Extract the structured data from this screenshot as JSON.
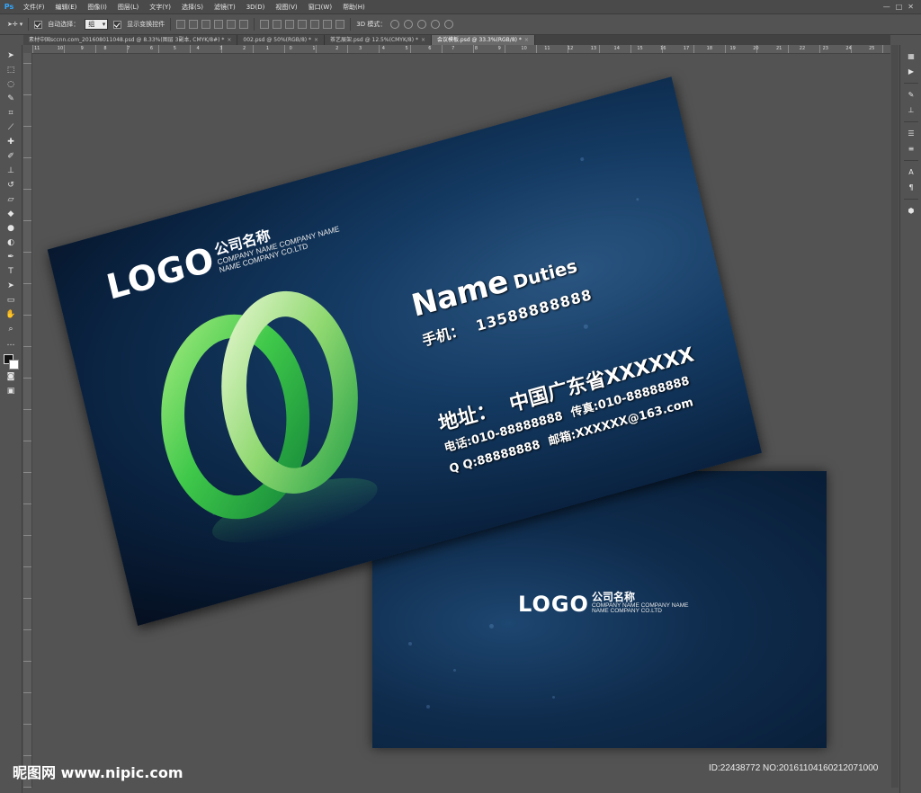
{
  "app": {
    "logo": "Ps",
    "menus": [
      "文件(F)",
      "编辑(E)",
      "图像(I)",
      "图层(L)",
      "文字(Y)",
      "选择(S)",
      "滤镜(T)",
      "3D(D)",
      "视图(V)",
      "窗口(W)",
      "帮助(H)"
    ],
    "window_controls": [
      "—",
      "□",
      "✕"
    ]
  },
  "options": {
    "auto_select_label": "自动选择：",
    "auto_select_value": "组",
    "show_transform_label": "显示变换控件",
    "mode_3d_label": "3D 模式："
  },
  "tabs": [
    {
      "label": "素材中国sccnn.com_20160801104​8.psd @ 8.33%(图层 3副本, CMYK/8#) *",
      "active": false
    },
    {
      "label": "002.psd @ 50%(RGB/8) *",
      "active": false
    },
    {
      "label": "茶艺展架.psd @ 12.5%(CMYK/8) *",
      "active": false
    },
    {
      "label": "会议模板.psd @ 33.3%(RGB/8) *",
      "active": true
    }
  ],
  "ruler_numbers": [
    "11",
    "10",
    "9",
    "8",
    "7",
    "6",
    "5",
    "4",
    "3",
    "2",
    "1",
    "0",
    "1",
    "2",
    "3",
    "4",
    "5",
    "6",
    "7",
    "8",
    "9",
    "10",
    "11",
    "12",
    "13",
    "14",
    "15",
    "16",
    "17",
    "18",
    "19",
    "20",
    "21",
    "22",
    "23",
    "24",
    "25"
  ],
  "front_card": {
    "logo": "LOGO",
    "company_cn": "公司名称",
    "company_en_1": "COMPANY NAME COMPANY NAME",
    "company_en_2": "NAME COMPANY CO.LTD",
    "name": "Name",
    "duties": "Duties",
    "mobile_label": "手机：",
    "mobile": "13588888888",
    "address_label": "地址：",
    "address": "中国广东省XXXXXX",
    "tel": "电话:010-88888888",
    "fax": "传真:010-88888888",
    "qq": "Q Q:88888888",
    "email": "邮箱:XXXXXX@163.com"
  },
  "back_card": {
    "logo": "LOGO",
    "company_cn": "公司名称",
    "company_en_1": "COMPANY NAME COMPANY NAME",
    "company_en_2": "NAME COMPANY CO.LTD"
  },
  "watermark": {
    "left": "昵图网 www.nipic.com",
    "right": "ID:22438772 NO:20161104160212071000"
  }
}
